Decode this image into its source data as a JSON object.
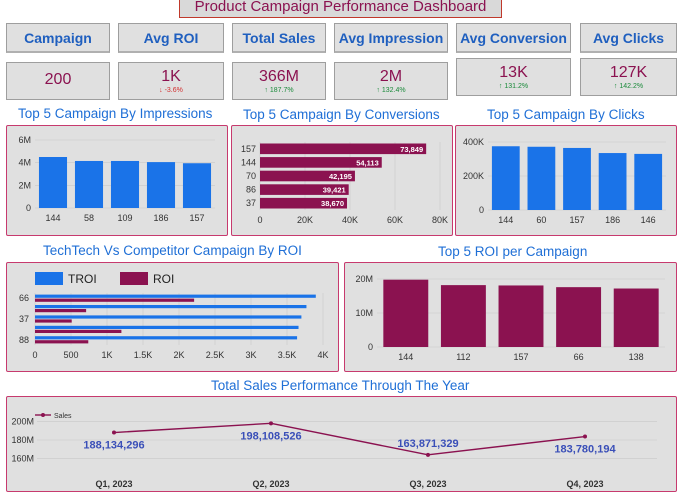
{
  "dashboard": {
    "title": "Product Campaign Performance Dashboard"
  },
  "headers": [
    "Campaign",
    "Avg ROI",
    "Total Sales",
    "Avg Impression",
    "Avg Conversion",
    "Avg Clicks"
  ],
  "kpis": [
    {
      "value": "200",
      "delta": "",
      "dir": ""
    },
    {
      "value": "1K",
      "delta": "-3.6%",
      "dir": "down"
    },
    {
      "value": "366M",
      "delta": "187.7%",
      "dir": "up"
    },
    {
      "value": "2M",
      "delta": "132.4%",
      "dir": "up"
    },
    {
      "value": "13K",
      "delta": "131.2%",
      "dir": "up"
    },
    {
      "value": "127K",
      "delta": "142.2%",
      "dir": "up"
    }
  ],
  "titles": {
    "impressions": "Top 5 Campaign By Impressions",
    "conversions": "Top 5 Campaign By Conversions",
    "clicks": "Top 5 Campaign By Clicks",
    "competitor": "TechTech Vs Competitor Campaign By ROI",
    "roi": "Top 5 ROI per Campaign",
    "sales": "Total Sales Performance Through The Year"
  },
  "chart_data": [
    {
      "id": "impressions",
      "type": "bar",
      "categories": [
        "144",
        "58",
        "109",
        "186",
        "157"
      ],
      "values": [
        4500000,
        4150000,
        4150000,
        4050000,
        3950000
      ],
      "yticks": [
        "0",
        "2M",
        "4M",
        "6M"
      ],
      "ylim": [
        0,
        6000000
      ],
      "color": "#1a73e8"
    },
    {
      "id": "conversions",
      "type": "bar",
      "orientation": "horizontal",
      "categories": [
        "157",
        "144",
        "70",
        "86",
        "37"
      ],
      "values": [
        73849,
        54113,
        42195,
        39421,
        38670
      ],
      "labels": [
        "73,849",
        "54,113",
        "42,195",
        "39,421",
        "38,670"
      ],
      "xticks": [
        "0",
        "20K",
        "40K",
        "60K",
        "80K"
      ],
      "xlim": [
        0,
        80000
      ],
      "color": "#8b1250"
    },
    {
      "id": "clicks",
      "type": "bar",
      "categories": [
        "144",
        "60",
        "157",
        "186",
        "146"
      ],
      "values": [
        375000,
        372000,
        365000,
        335000,
        330000
      ],
      "yticks": [
        "0",
        "200K",
        "400K"
      ],
      "ylim": [
        0,
        400000
      ],
      "color": "#1a73e8"
    },
    {
      "id": "competitor",
      "type": "bar",
      "orientation": "horizontal",
      "categories": [
        "66",
        "",
        "37",
        "",
        "88"
      ],
      "series": [
        {
          "name": "TROI",
          "color": "#1a73e8",
          "values": [
            3900,
            3770,
            3700,
            3660,
            3640
          ]
        },
        {
          "name": "ROI",
          "color": "#8b1250",
          "values": [
            2210,
            710,
            510,
            1200,
            740
          ]
        }
      ],
      "xticks": [
        "0",
        "500",
        "1K",
        "1.5K",
        "2K",
        "2.5K",
        "3K",
        "3.5K",
        "4K"
      ],
      "xlim": [
        0,
        4000
      ]
    },
    {
      "id": "roi",
      "type": "bar",
      "categories": [
        "144",
        "112",
        "157",
        "66",
        "138"
      ],
      "values": [
        19800000,
        18200000,
        18100000,
        17600000,
        17200000
      ],
      "yticks": [
        "0",
        "10M",
        "20M"
      ],
      "ylim": [
        0,
        20000000
      ],
      "color": "#8b1250"
    },
    {
      "id": "sales",
      "type": "line",
      "categories": [
        "Q1, 2023",
        "Q2, 2023",
        "Q3, 2023",
        "Q4, 2023"
      ],
      "series": [
        {
          "name": "Sales",
          "color": "#8b1250",
          "values": [
            188134296,
            198108526,
            163871329,
            183780194
          ]
        }
      ],
      "labels": [
        "188,134,296",
        "198,108,526",
        "163,871,329",
        "183,780,194"
      ],
      "yticks": [
        "160M",
        "180M",
        "200M"
      ],
      "ylim": [
        155000000,
        205000000
      ]
    }
  ]
}
